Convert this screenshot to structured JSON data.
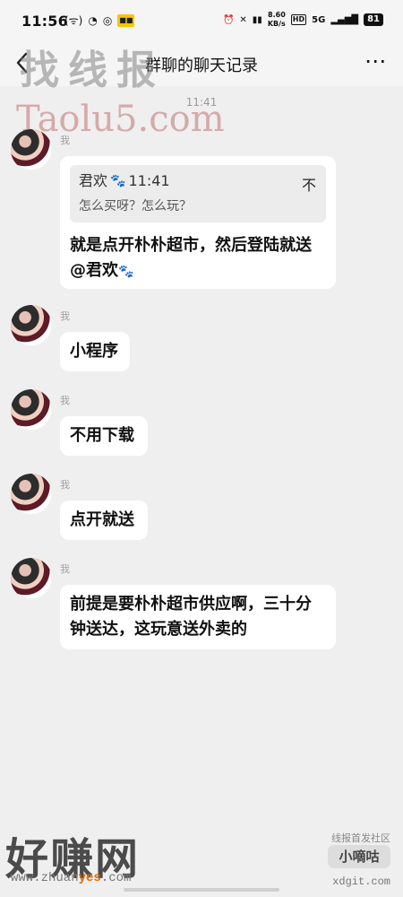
{
  "status_bar": {
    "time": "11:56",
    "icons_left": [
      "signal-icon",
      "wechat-icon",
      "app-icon",
      "notification-badge-icon"
    ],
    "speed_top": "8.60",
    "speed_bottom": "KB/s",
    "hd": "HD",
    "network": "5G",
    "battery": "81"
  },
  "header": {
    "back_label": "‹",
    "title": "群聊的聊天记录",
    "more_label": "⋯"
  },
  "watermarks": {
    "top": "找线报",
    "top_url": "Taolu5.com",
    "bottom_left": "好赚网",
    "bottom_url": {
      "prefix": "www.zhuan",
      "highlight": "yes",
      "suffix": ".com"
    },
    "right_small": "线报首发社区",
    "right_brand": "小嘀咕",
    "right_domain": "xdgit.com"
  },
  "chat": {
    "timestamp": "11:41",
    "sender_label": "我",
    "messages": [
      {
        "quote": {
          "name": "君欢",
          "time": "11:41",
          "text": "怎么买呀？怎么玩？",
          "close": "不"
        },
        "text": "就是点开朴朴超市，然后登陆就送@君欢",
        "emoji": "🐾"
      },
      {
        "text": "小程序"
      },
      {
        "text": "不用下载"
      },
      {
        "text": "点开就送"
      },
      {
        "text": "前提是要朴朴超市供应啊，三十分钟送达，这玩意送外卖的"
      }
    ]
  }
}
